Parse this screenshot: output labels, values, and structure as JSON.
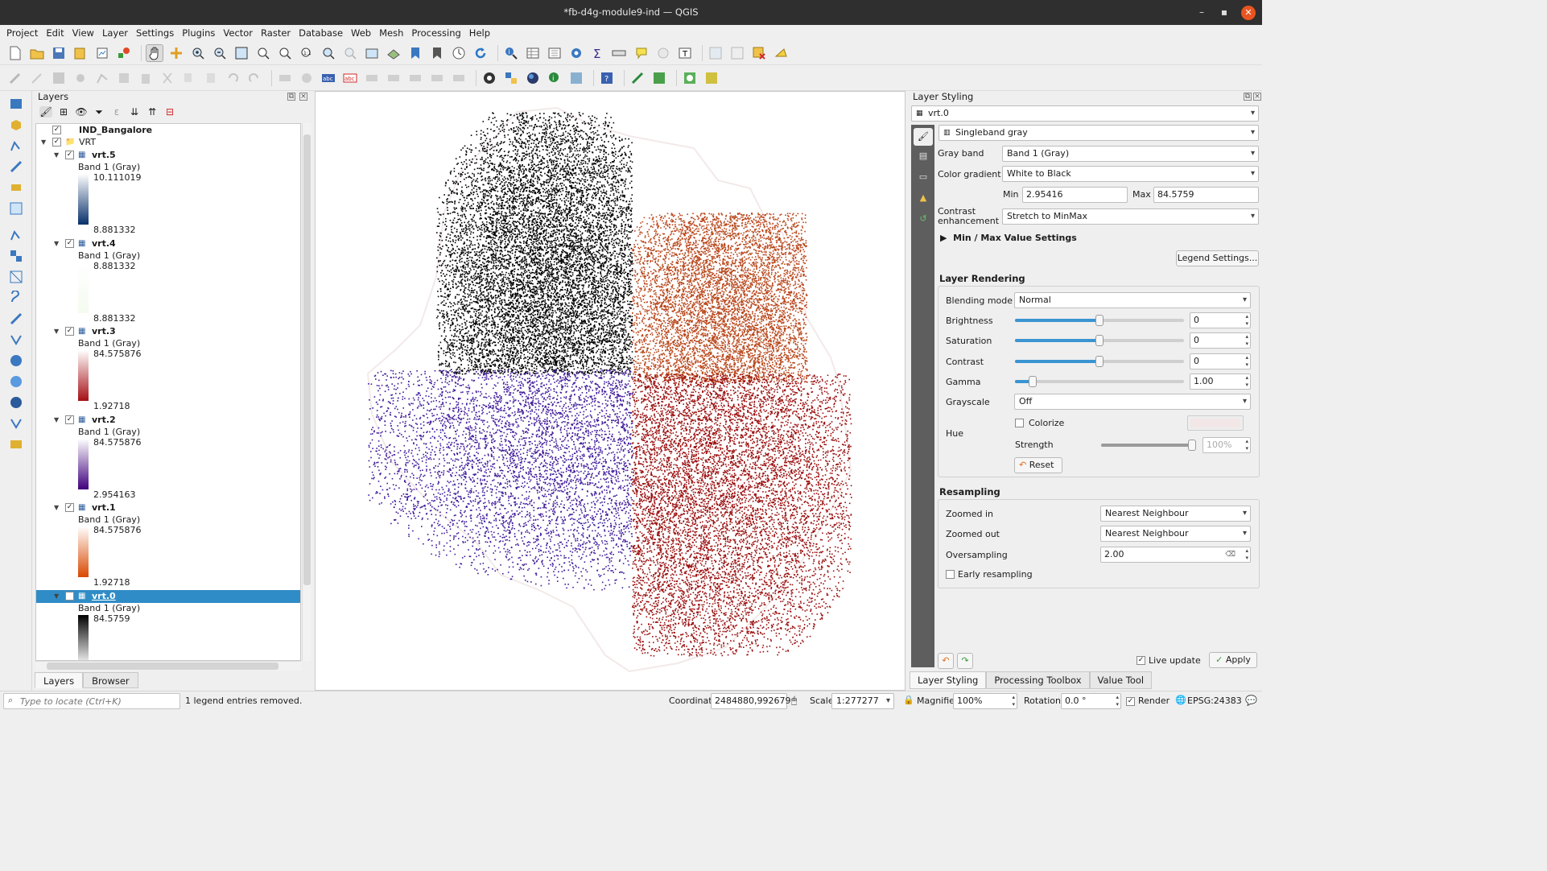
{
  "window": {
    "title": "*fb-d4g-module9-ind — QGIS",
    "minimize": "–",
    "maximize": "▪",
    "close": "✕"
  },
  "menu": [
    "Project",
    "Edit",
    "View",
    "Layer",
    "Settings",
    "Plugins",
    "Vector",
    "Raster",
    "Database",
    "Web",
    "Mesh",
    "Processing",
    "Help"
  ],
  "layers_panel": {
    "title": "Layers",
    "group_top": "IND_Bangalore",
    "group": "VRT",
    "items": [
      {
        "name": "vrt.5",
        "band": "Band 1 (Gray)",
        "max": "10.111019",
        "min": "8.881332",
        "ramp": "linear-gradient(#ffffff,#08306b)"
      },
      {
        "name": "vrt.4",
        "band": "Band 1 (Gray)",
        "max": "8.881332",
        "min": "8.881332",
        "ramp": "linear-gradient(#ffffff,#f4fbf0)"
      },
      {
        "name": "vrt.3",
        "band": "Band 1 (Gray)",
        "max": "84.575876",
        "min": "1.92718",
        "ramp": "linear-gradient(#ffffff,#a50f15)"
      },
      {
        "name": "vrt.2",
        "band": "Band 1 (Gray)",
        "max": "84.575876",
        "min": "2.954163",
        "ramp": "linear-gradient(#ffffff,#3f007d)"
      },
      {
        "name": "vrt.1",
        "band": "Band 1 (Gray)",
        "max": "84.575876",
        "min": "1.92718",
        "ramp": "linear-gradient(#ffffff,#d94801)"
      },
      {
        "name": "vrt.0",
        "band": "Band 1 (Gray)",
        "max": "84.5759",
        "min": "",
        "ramp": "linear-gradient(#000000,#ffffff)"
      }
    ],
    "tabs": [
      "Layers",
      "Browser"
    ]
  },
  "styling": {
    "title": "Layer Styling",
    "layer": "vrt.0",
    "renderer": "Singleband gray",
    "gray_band_label": "Gray band",
    "gray_band": "Band 1 (Gray)",
    "gradient_label": "Color gradient",
    "gradient": "White to Black",
    "min_label": "Min",
    "min": "2.95416",
    "max_label": "Max",
    "max": "84.5759",
    "contrast_label": "Contrast enhancement",
    "contrast": "Stretch to MinMax",
    "minmax_settings": "Min / Max Value Settings",
    "legend_settings": "Legend Settings...",
    "rendering_title": "Layer Rendering",
    "blending_label": "Blending mode",
    "blending": "Normal",
    "brightness_label": "Brightness",
    "brightness": "0",
    "saturation_label": "Saturation",
    "saturation": "0",
    "contrast2_label": "Contrast",
    "contrast2": "0",
    "gamma_label": "Gamma",
    "gamma": "1.00",
    "grayscale_label": "Grayscale",
    "grayscale": "Off",
    "hue_label": "Hue",
    "colorize": "Colorize",
    "strength_label": "Strength",
    "strength": "100%",
    "reset": "Reset",
    "resampling_title": "Resampling",
    "zoomed_in_label": "Zoomed in",
    "zoomed_in": "Nearest Neighbour",
    "zoomed_out_label": "Zoomed out",
    "zoomed_out": "Nearest Neighbour",
    "oversampling_label": "Oversampling",
    "oversampling": "2.00",
    "early_resampling": "Early resampling",
    "live_update": "Live update",
    "apply": "Apply",
    "tabs": [
      "Layer Styling",
      "Processing Toolbox",
      "Value Tool"
    ]
  },
  "status": {
    "locator_placeholder": "Type to locate (Ctrl+K)",
    "message": "1 legend entries removed.",
    "coordinate_label": "Coordinate",
    "coordinate": "2484880,992679",
    "scale_label": "Scale",
    "scale": "1:277277",
    "magnifier_label": "Magnifier",
    "magnifier": "100%",
    "rotation_label": "Rotation",
    "rotation": "0.0 °",
    "render_label": "Render",
    "crs": "EPSG:24383"
  },
  "colors": {
    "accent": "#308cc6",
    "titlebar": "#2f2f2f",
    "close": "#e95420",
    "q_black": "#000000",
    "q_orange": "#b8461a",
    "q_purple": "#3f1a9a",
    "q_red": "#9a0d0d"
  }
}
